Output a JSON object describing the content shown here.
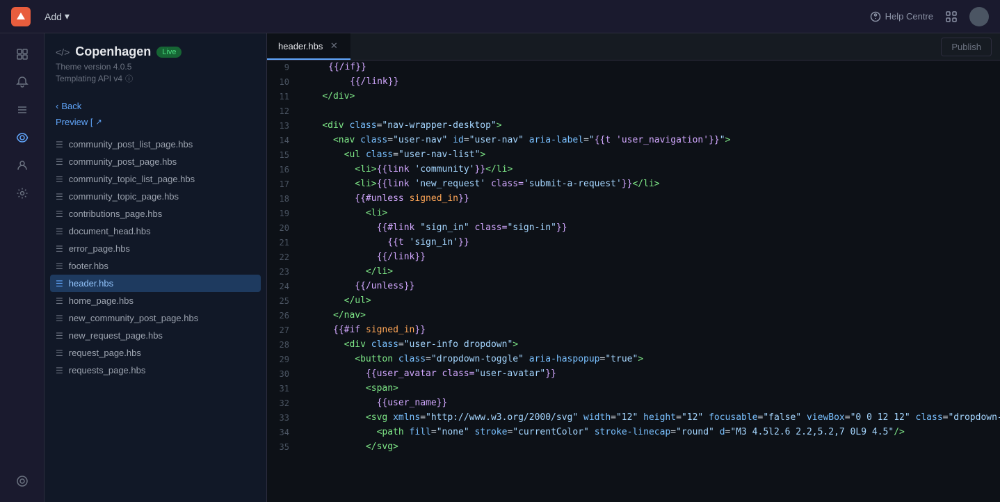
{
  "topbar": {
    "add_label": "Add",
    "help_label": "Help Centre"
  },
  "theme": {
    "icon": "</>",
    "name": "Copenhagen",
    "badge": "Live",
    "version": "Theme version 4.0.5",
    "api": "Templating API v4"
  },
  "nav": {
    "back_label": "Back",
    "preview_label": "Preview [",
    "publish_label": "Publish"
  },
  "active_tab": "header.hbs",
  "files": [
    {
      "name": "community_post_list_page.hbs",
      "type": "file",
      "active": false
    },
    {
      "name": "community_post_page.hbs",
      "type": "file",
      "active": false
    },
    {
      "name": "community_topic_list_page.hbs",
      "type": "file",
      "active": false
    },
    {
      "name": "community_topic_page.hbs",
      "type": "file",
      "active": false
    },
    {
      "name": "contributions_page.hbs",
      "type": "file",
      "active": false
    },
    {
      "name": "document_head.hbs",
      "type": "file",
      "active": false
    },
    {
      "name": "error_page.hbs",
      "type": "file",
      "active": false
    },
    {
      "name": "footer.hbs",
      "type": "file",
      "active": false
    },
    {
      "name": "header.hbs",
      "type": "file",
      "active": true
    },
    {
      "name": "home_page.hbs",
      "type": "file",
      "active": false
    },
    {
      "name": "new_community_post_page.hbs",
      "type": "file",
      "active": false
    },
    {
      "name": "new_request_page.hbs",
      "type": "file",
      "active": false
    },
    {
      "name": "request_page.hbs",
      "type": "file",
      "active": false
    },
    {
      "name": "requests_page.hbs",
      "type": "file",
      "active": false
    }
  ],
  "code_lines": [
    {
      "num": "9",
      "content": "        {{/if}}"
    },
    {
      "num": "10",
      "content": "      {{/link}}"
    },
    {
      "num": "11",
      "content": "    </div>"
    },
    {
      "num": "12",
      "content": ""
    },
    {
      "num": "13",
      "content": "    <div class=\"nav-wrapper-desktop\">"
    },
    {
      "num": "14",
      "content": "      <nav class=\"user-nav\" id=\"user-nav\" aria-label=\"{{t 'user_navigation'}}\">"
    },
    {
      "num": "15",
      "content": "        <ul class=\"user-nav-list\">"
    },
    {
      "num": "16",
      "content": "          <li>{{link 'community'}}</li>"
    },
    {
      "num": "17",
      "content": "          <li>{{link 'new_request' class='submit-a-request'}}</li>"
    },
    {
      "num": "18",
      "content": "          {{#unless signed_in}}"
    },
    {
      "num": "19",
      "content": "            <li>"
    },
    {
      "num": "20",
      "content": "              {{#link \"sign_in\" class=\"sign-in\"}}"
    },
    {
      "num": "21",
      "content": "                {{t 'sign_in'}}"
    },
    {
      "num": "22",
      "content": "              {{/link}}"
    },
    {
      "num": "23",
      "content": "            </li>"
    },
    {
      "num": "24",
      "content": "          {{/unless}}"
    },
    {
      "num": "25",
      "content": "        </ul>"
    },
    {
      "num": "26",
      "content": "      </nav>"
    },
    {
      "num": "27",
      "content": "      {{#if signed_in}}"
    },
    {
      "num": "28",
      "content": "        <div class=\"user-info dropdown\">"
    },
    {
      "num": "29",
      "content": "          <button class=\"dropdown-toggle\" aria-haspopup=\"true\">"
    },
    {
      "num": "30",
      "content": "            {{user_avatar class=\"user-avatar\"}}"
    },
    {
      "num": "31",
      "content": "            <span>"
    },
    {
      "num": "32",
      "content": "              {{user_name}}"
    },
    {
      "num": "33",
      "content": "            <svg xmlns=\"http://www.w3.org/2000/svg\" width=\"12\" height=\"12\" focusable=\"false\" viewBox=\"0 0 12 12\" class=\"dropdown-chevron-icon\" aria-hidden=\"true\">"
    },
    {
      "num": "34",
      "content": "              <path fill=\"none\" stroke=\"currentColor\" stroke-linecap=\"round\" d=\"M3 4.5l2.6 2.2,5.2,7 0L9 4.5\"/>"
    },
    {
      "num": "35",
      "content": "            </svg>"
    }
  ]
}
